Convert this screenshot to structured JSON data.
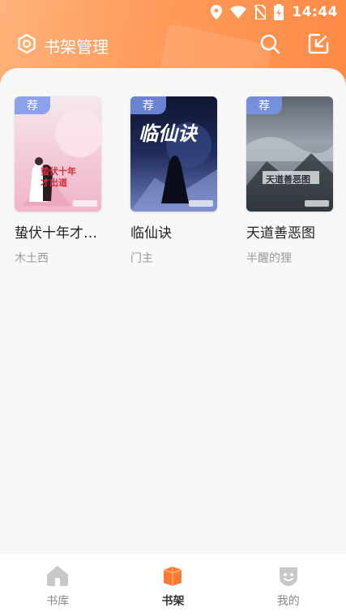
{
  "status_bar": {
    "time": "14:44"
  },
  "header": {
    "title": "书架管理",
    "icons": [
      "gear-icon",
      "search-icon",
      "import-icon"
    ]
  },
  "books": [
    {
      "tag": "荐",
      "title": "蛰伏十年才出道",
      "title_display": "蛰伏十年才…",
      "author": "木土西",
      "cover_text": "蛰伏十年才出道"
    },
    {
      "tag": "荐",
      "title": "临仙诀",
      "title_display": "临仙诀",
      "author": "门主",
      "cover_text": "临仙诀"
    },
    {
      "tag": "荐",
      "title": "天道善恶图",
      "title_display": "天道善恶图",
      "author": "半醒的狸",
      "cover_text": "天道善恶图"
    }
  ],
  "bottom_nav": {
    "items": [
      {
        "label": "书库",
        "icon": "home-icon",
        "active": false
      },
      {
        "label": "书架",
        "icon": "bookshelf-icon",
        "active": true
      },
      {
        "label": "我的",
        "icon": "profile-icon",
        "active": false
      }
    ]
  },
  "colors": {
    "accent": "#ff8a45",
    "tag_bg": "#7896eb",
    "nav_active": "#ff7a30",
    "nav_inactive": "#c8c8c8"
  }
}
